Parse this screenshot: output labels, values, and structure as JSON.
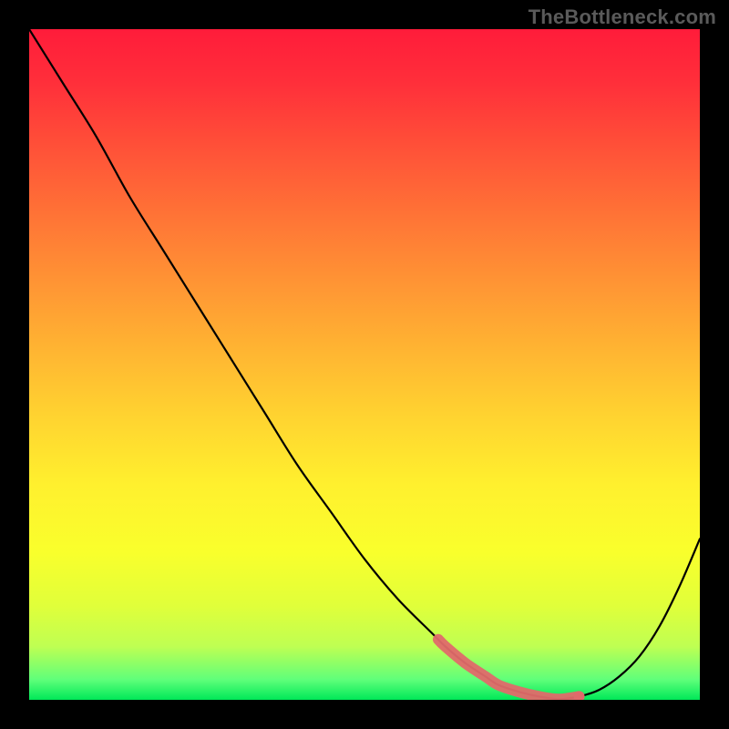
{
  "watermark": "TheBottleneck.com",
  "colors": {
    "background": "#000000",
    "curve": "#000000",
    "highlight": "#e06a6a",
    "gradient_top": "#ff1c3a",
    "gradient_bottom": "#00e858"
  },
  "chart_data": {
    "type": "line",
    "title": "",
    "xlabel": "",
    "ylabel": "",
    "xlim": [
      0,
      100
    ],
    "ylim": [
      0,
      100
    ],
    "grid": false,
    "note": "Positions inferred from pixels; axes have no ticks or labels in the figure. y is plotted inverted (0 at top, 100 at bottom).",
    "series": [
      {
        "name": "bottleneck-curve",
        "x": [
          0,
          5,
          10,
          15,
          20,
          25,
          30,
          35,
          40,
          45,
          50,
          55,
          60,
          62,
          65,
          68,
          70,
          73,
          76,
          79,
          82,
          85,
          88,
          91,
          94,
          97,
          100
        ],
        "y": [
          0,
          8,
          16,
          25,
          33,
          41,
          49,
          57,
          65,
          72,
          79,
          85,
          90,
          92,
          94.5,
          96.5,
          97.8,
          98.8,
          99.5,
          99.9,
          99.5,
          98.5,
          96.5,
          93.5,
          89,
          83,
          76
        ]
      }
    ],
    "highlight_range": {
      "description": "Segment of the curve near the minimum shown with a thick red overlay.",
      "x_start": 61,
      "x_end": 82
    }
  }
}
